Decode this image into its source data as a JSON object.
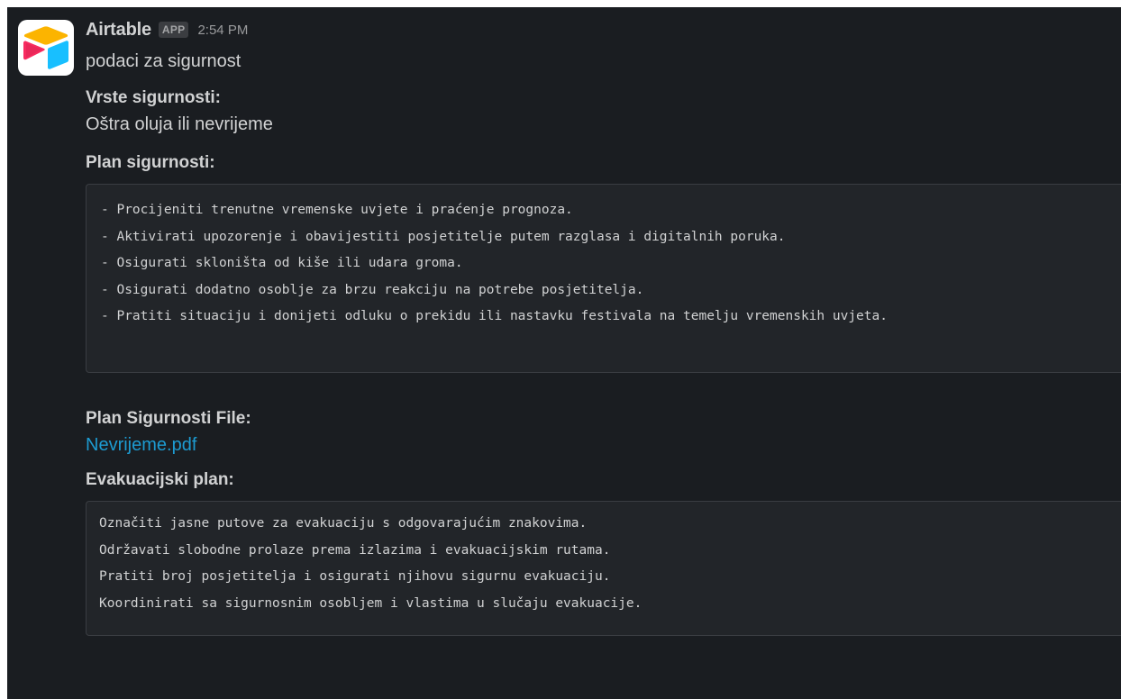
{
  "message": {
    "sender": "Airtable",
    "badge": "APP",
    "time": "2:54 PM",
    "intro": "podaci za sigurnost",
    "fields": {
      "vrste_label": "Vrste sigurnosti:",
      "vrste_value": "Oštra oluja ili nevrijeme",
      "plan_label": "Plan sigurnosti:",
      "plan_lines": [
        "- Procijeniti trenutne vremenske uvjete i praćenje prognoza.",
        "- Aktivirati upozorenje i obavijestiti posjetitelje putem razglasa i digitalnih poruka.",
        "- Osigurati skloništa od kiše ili udara groma.",
        "- Osigurati dodatno osoblje za brzu reakciju na potrebe posjetitelja.",
        "- Pratiti situaciju i donijeti odluku o prekidu ili nastavku festivala na temelju vremenskih uvjeta."
      ],
      "file_label": "Plan Sigurnosti File:",
      "file_link": "Nevrijeme.pdf",
      "evak_label": "Evakuacijski plan:",
      "evak_lines": [
        "Označiti jasne putove za evakuaciju s odgovarajućim znakovima.",
        "Održavati slobodne prolaze prema izlazima i evakuacijskim rutama.",
        "Pratiti broj posjetitelja i osigurati njihovu sigurnu evakuaciju.",
        "Koordinirati sa sigurnosnim osobljem i vlastima u slučaju evakuacije."
      ]
    }
  },
  "colors": {
    "background": "#1a1d21",
    "link": "#1d9bd1",
    "logo_yellow": "#fcb400",
    "logo_red": "#f82b60",
    "logo_blue": "#2d7ff9",
    "logo_cyan": "#18bfff"
  },
  "icons": {
    "avatar": "airtable-logo-icon"
  }
}
